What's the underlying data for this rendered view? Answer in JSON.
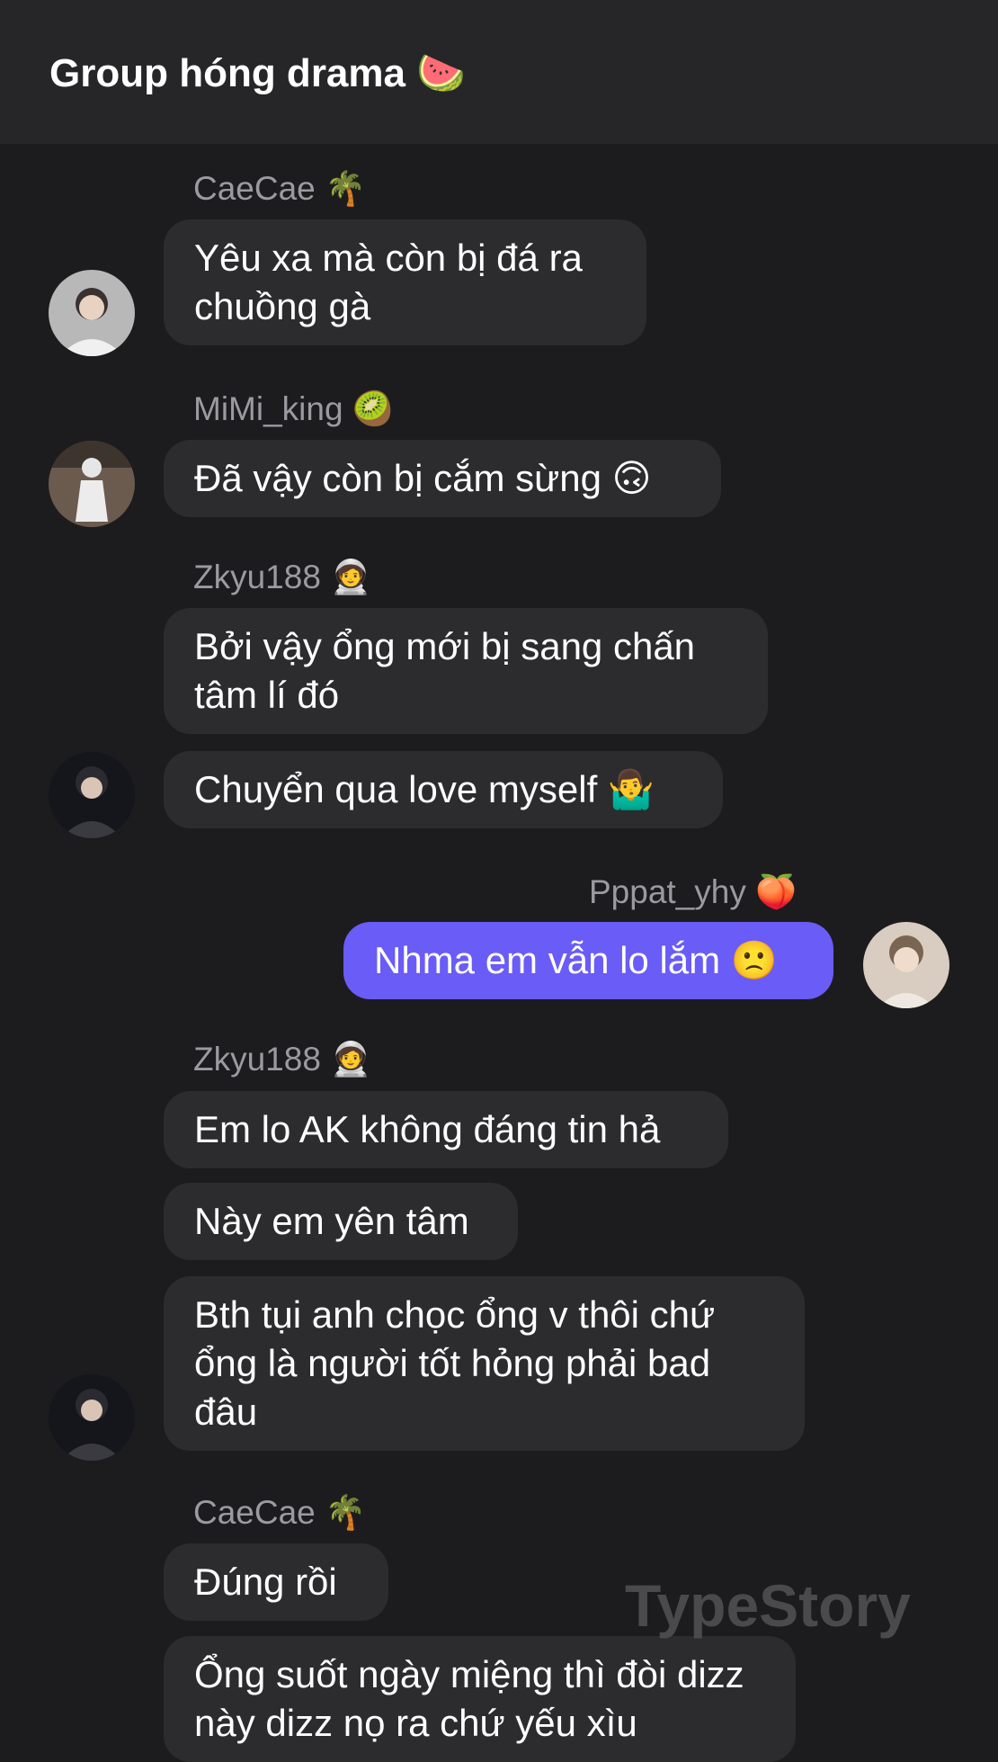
{
  "header": {
    "title": "Group hóng drama 🍉"
  },
  "messages": [
    {
      "sender": "CaeCae 🌴",
      "text": "Yêu xa mà còn bị đá ra chuồng gà"
    },
    {
      "sender": "MiMi_king 🥝",
      "text": "Đã vậy còn bị cắm sừng 🙃"
    },
    {
      "sender": "Zkyu188 🧑‍🚀",
      "texts": [
        "Bởi vậy ổng mới bị sang chấn tâm lí đó",
        "Chuyển qua love myself 🤷‍♂️"
      ]
    },
    {
      "sender": "Pppat_yhy 🍑",
      "text": "Nhma em vẫn lo lắm 🙁",
      "me": true
    },
    {
      "sender": "Zkyu188 🧑‍🚀",
      "texts": [
        "Em lo AK không đáng tin hả",
        "Này em yên tâm",
        "Bth tụi anh chọc ổng v thôi chứ ổng là người tốt hỏng phải bad đâu"
      ]
    },
    {
      "sender": "CaeCae 🌴",
      "texts": [
        "Đúng rồi",
        "Ổng suốt ngày miệng thì đòi dizz này dizz nọ ra chứ yếu xìu"
      ]
    }
  ],
  "watermark": "TypeStory",
  "colors": {
    "background": "#1c1c1e",
    "header": "#262628",
    "bubble": "#2c2c2e",
    "my_bubble": "#6a5cf6"
  }
}
